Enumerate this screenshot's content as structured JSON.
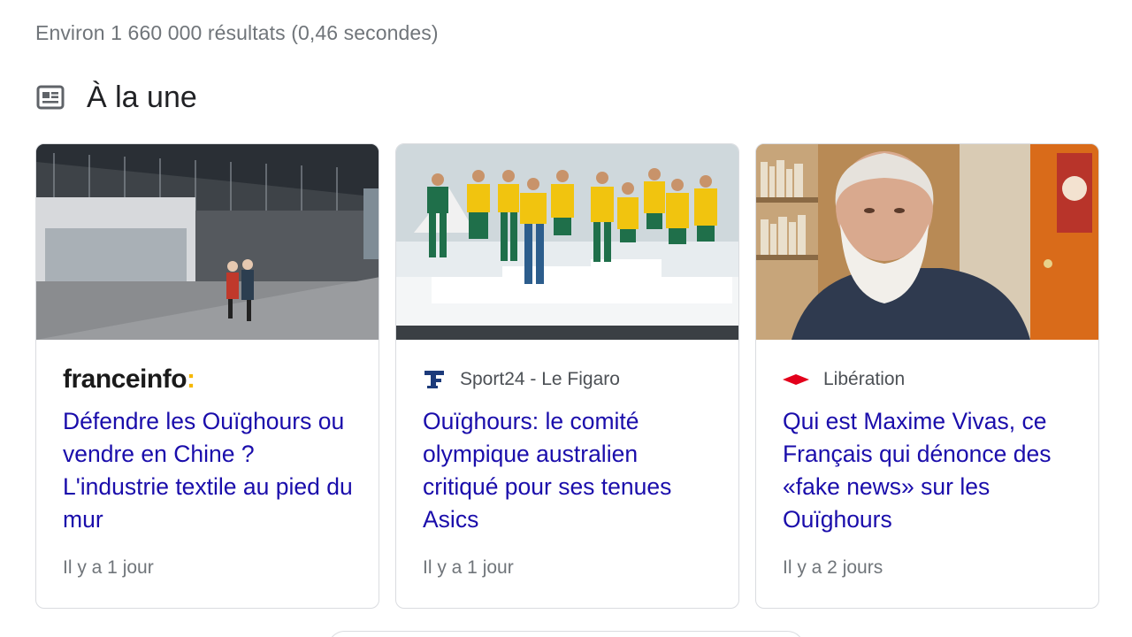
{
  "result_stats": "Environ 1 660 000 résultats (0,46 secondes)",
  "top_stories": {
    "title": "À la une",
    "icon": "newspaper-icon",
    "cards": [
      {
        "source_logo_text": "franceinfo",
        "source_logo_colon": ":",
        "headline": "Défendre les Ouïghours ou vendre en Chine ? L'industrie textile au pied du mur",
        "time": "Il y a 1 jour"
      },
      {
        "source_icon": "le-figaro-icon",
        "source": "Sport24 - Le Figaro",
        "headline": "Ouïghours: le comité olympique australien critiqué pour ses tenues Asics",
        "time": "Il y a 1 jour"
      },
      {
        "source_icon": "liberation-icon",
        "source": "Libération",
        "headline": "Qui est Maxime Vivas, ce Français qui dénonce des «fake news» sur les Ouïghours",
        "time": "Il y a 2 jours"
      }
    ]
  },
  "colors": {
    "link": "#1a0dab",
    "meta": "#70757a",
    "franceinfo_accent": "#f6b800",
    "liberation_red": "#e3001b",
    "figaro_blue": "#1c3a7a"
  }
}
